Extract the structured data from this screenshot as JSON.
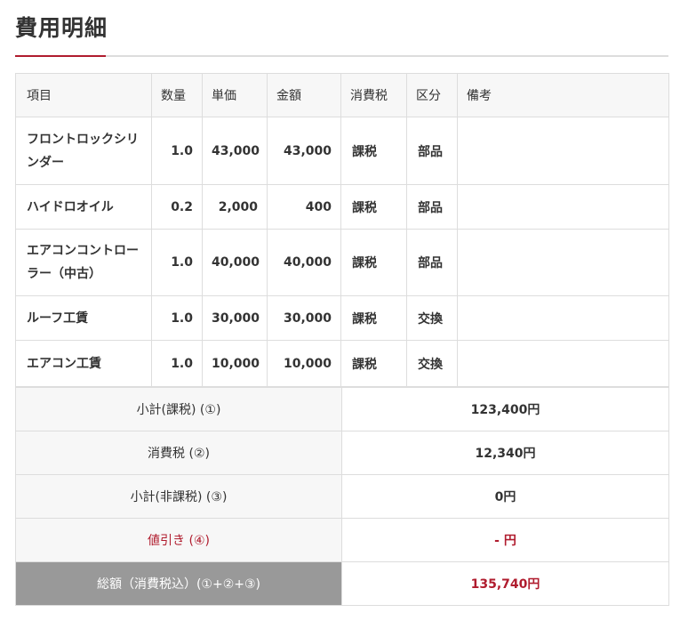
{
  "section": {
    "title": "費用明細"
  },
  "columns": [
    "項目",
    "数量",
    "単価",
    "金額",
    "消費税",
    "区分",
    "備考"
  ],
  "rows": [
    {
      "item": "フロントロックシリンダー",
      "qty": "1.0",
      "unit_price": "43,000",
      "amount": "43,000",
      "tax": "課税",
      "category": "部品",
      "note": ""
    },
    {
      "item": "ハイドロオイル",
      "qty": "0.2",
      "unit_price": "2,000",
      "amount": "400",
      "tax": "課税",
      "category": "部品",
      "note": ""
    },
    {
      "item": "エアコンコントローラー（中古）",
      "qty": "1.0",
      "unit_price": "40,000",
      "amount": "40,000",
      "tax": "課税",
      "category": "部品",
      "note": ""
    },
    {
      "item": "ルーフ工賃",
      "qty": "1.0",
      "unit_price": "30,000",
      "amount": "30,000",
      "tax": "課税",
      "category": "交換",
      "note": ""
    },
    {
      "item": "エアコン工賃",
      "qty": "1.0",
      "unit_price": "10,000",
      "amount": "10,000",
      "tax": "課税",
      "category": "交換",
      "note": ""
    }
  ],
  "summary": {
    "subtotal_taxable": {
      "label": "小計(課税) (①)",
      "value": "123,400円"
    },
    "consumption_tax": {
      "label": "消費税 (②)",
      "value": "12,340円"
    },
    "subtotal_nontaxable": {
      "label": "小計(非課税) (③)",
      "value": "0円"
    },
    "discount": {
      "label": "値引き (④)",
      "value": "- 円"
    },
    "total": {
      "label": "総額（消費税込）(①+②+③)",
      "value": "135,740円"
    }
  },
  "colors": {
    "accent": "#b01c2e",
    "border": "#dddddd",
    "header_bg": "#f7f7f7",
    "total_label_bg": "#999999"
  }
}
